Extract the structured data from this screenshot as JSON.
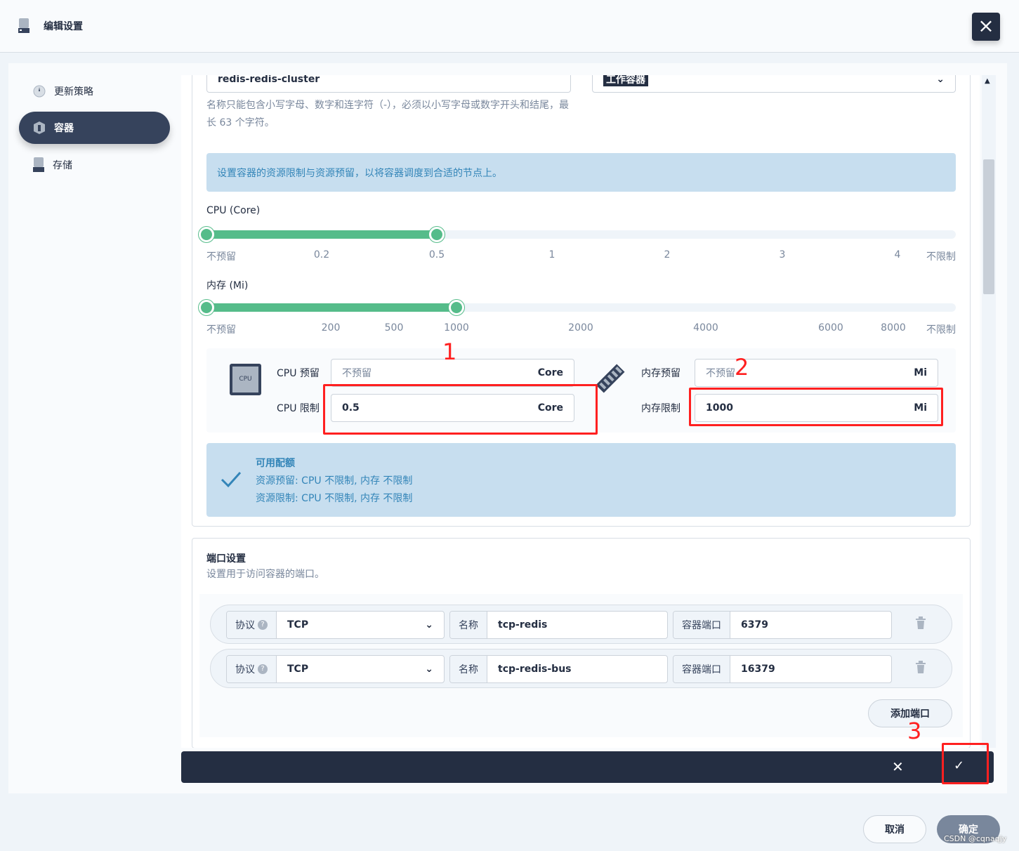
{
  "header": {
    "title": "编辑设置",
    "close_icon": "close-icon"
  },
  "sidebar": {
    "items": [
      {
        "label": "更新策略",
        "icon": "clock-icon"
      },
      {
        "label": "容器",
        "icon": "container-icon",
        "active": true
      },
      {
        "label": "存储",
        "icon": "storage-icon"
      }
    ]
  },
  "form": {
    "name_value": "redis-redis-cluster",
    "type_value": "工作容器",
    "name_hint": "名称只能包含小写字母、数字和连字符（-），必须以小写字母或数字开头和结尾，最长 63 个字符。"
  },
  "resources": {
    "info": "设置容器的资源限制与资源预留，以将容器调度到合适的节点上。",
    "cpu": {
      "label": "CPU (Core)",
      "ticks": [
        "不预留",
        "0.2",
        "0.5",
        "1",
        "2",
        "3",
        "4",
        "不限制"
      ],
      "range": [
        "不预留",
        "0.5"
      ]
    },
    "memory": {
      "label": "内存 (Mi)",
      "ticks": [
        "不预留",
        "200",
        "500",
        "1000",
        "2000",
        "4000",
        "6000",
        "8000",
        "不限制"
      ],
      "range": [
        "不预留",
        "1000"
      ]
    },
    "cpu_request_label": "CPU 预留",
    "cpu_request_placeholder": "不预留",
    "cpu_limit_label": "CPU 限制",
    "cpu_limit_value": "0.5",
    "cpu_unit": "Core",
    "cpu_icon_text": "CPU",
    "mem_request_label": "内存预留",
    "mem_request_placeholder": "不预留",
    "mem_limit_label": "内存限制",
    "mem_limit_value": "1000",
    "mem_unit": "Mi",
    "quota_title": "可用配额",
    "quota_requests": "资源预留:  CPU 不限制, 内存 不限制",
    "quota_limits": "资源限制:  CPU 不限制, 内存 不限制"
  },
  "ports": {
    "title": "端口设置",
    "desc": "设置用于访问容器的端口。",
    "protocol_label": "协议",
    "name_label": "名称",
    "port_label": "容器端口",
    "rows": [
      {
        "protocol": "TCP",
        "name": "tcp-redis",
        "port": "6379"
      },
      {
        "protocol": "TCP",
        "name": "tcp-redis-bus",
        "port": "16379"
      }
    ],
    "add_label": "添加端口"
  },
  "annotations": [
    "1",
    "2",
    "3"
  ],
  "footer": {
    "cancel": "取消",
    "ok": "确定",
    "watermark": "CSDN @cqnaqjy"
  }
}
